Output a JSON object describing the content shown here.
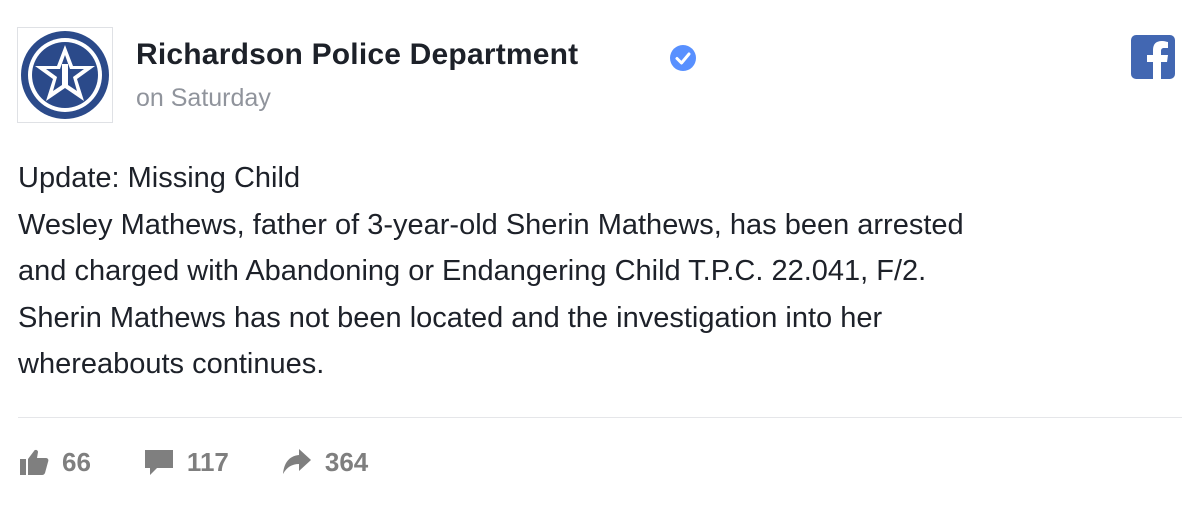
{
  "header": {
    "page_name": "Richardson Police Department",
    "timestamp": "on Saturday",
    "verified_icon": "verified-badge-icon",
    "platform_icon": "facebook-icon",
    "colors": {
      "verified": "#5890ff",
      "facebook": "#4267b2",
      "badge_blue": "#2b4a8a"
    }
  },
  "post": {
    "lines": [
      "Update: Missing Child",
      "Wesley Mathews, father of 3-year-old Sherin Mathews, has been arrested",
      "and charged with Abandoning or Endangering Child T.P.C. 22.041, F/2.",
      "Sherin Mathews has not been located and the investigation into her",
      "whereabouts continues."
    ]
  },
  "footer": {
    "likes": {
      "icon": "thumbs-up-icon",
      "count": "66"
    },
    "comments": {
      "icon": "comment-icon",
      "count": "117"
    },
    "shares": {
      "icon": "share-arrow-icon",
      "count": "364"
    }
  }
}
